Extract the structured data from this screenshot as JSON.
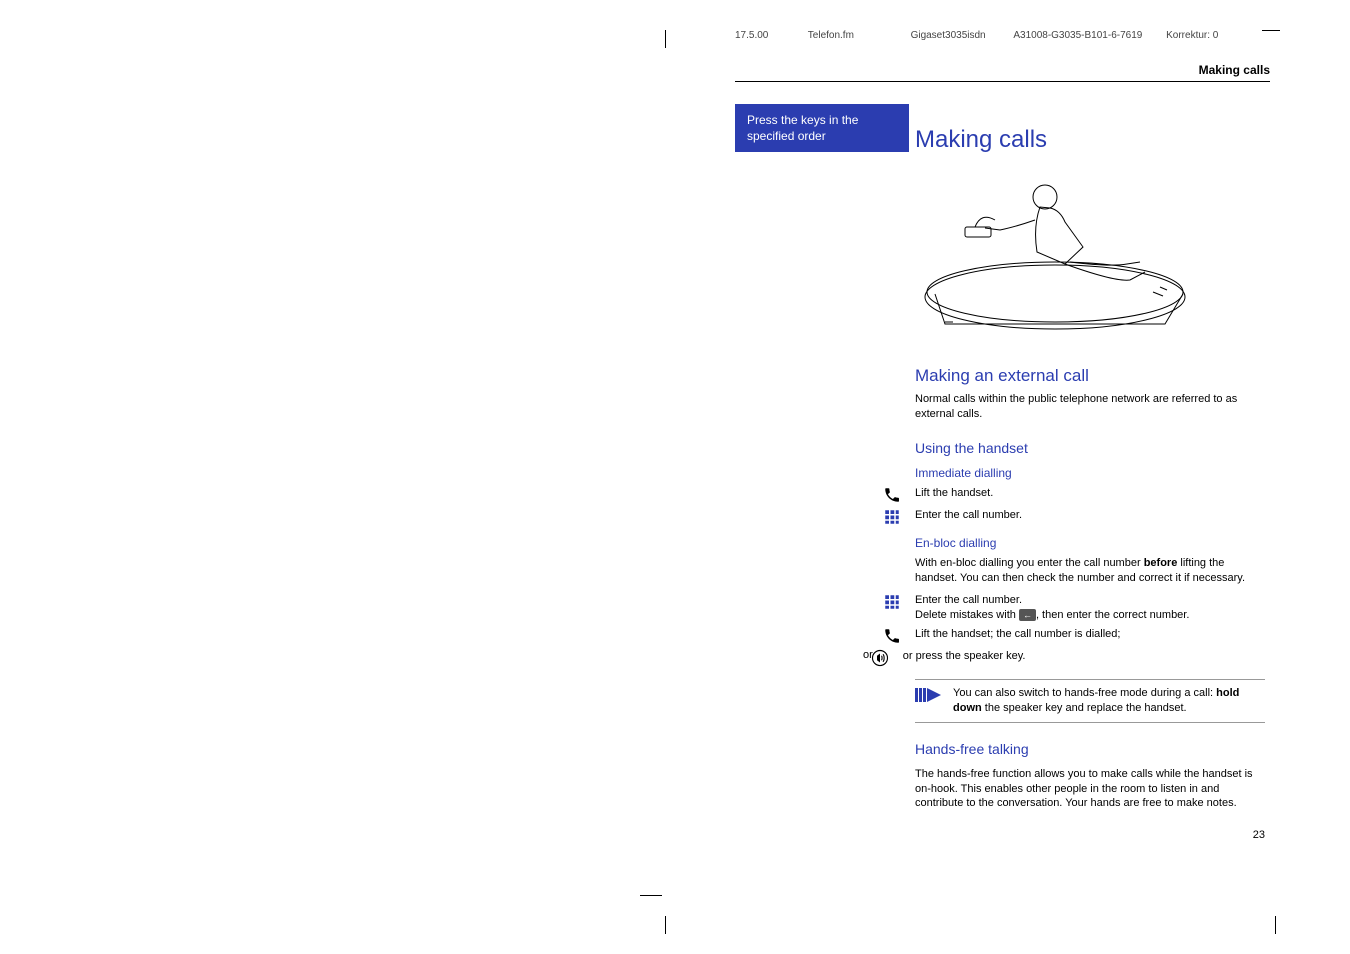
{
  "header": {
    "date": "17.5.00",
    "file": "Telefon.fm",
    "model": "Gigaset3035isdn",
    "partno": "A31008-G3035-B101-6-7619",
    "korrektur": "Korrektur: 0"
  },
  "page_title_right": "Making calls",
  "tip_box": "Press the keys in the specified order",
  "h1": "Making calls",
  "section1": {
    "title": "Making an external call",
    "body": "Normal calls within the public telephone network are referred to as external calls."
  },
  "section2": {
    "title": "Using the handset",
    "immediate": {
      "title": "Immediate dialling",
      "step1": "Lift the handset.",
      "step2": "Enter the call number."
    },
    "enbloc": {
      "title": "En-bloc dialling",
      "intro_before": "With en-bloc dialling you enter the call number ",
      "intro_bold": "before",
      "intro_after": " lifting the handset. You can then check the number and correct it if necessary.",
      "step1a": "Enter the call number.",
      "step1b_before": "Delete mistakes with ",
      "step1b_after": ", then enter the correct number.",
      "step2": "Lift the handset; the call number is dialled;",
      "or_label": "or",
      "step3": "or press the speaker key."
    },
    "note_before": "You can also switch to hands-free mode during a call: ",
    "note_bold": "hold down",
    "note_after": " the speaker key and replace the handset."
  },
  "section3": {
    "title": "Hands-free talking",
    "body": "The hands-free function allows you to make calls while the handset is on-hook. This enables other people in the room to listen in and contribute to the conversation. Your hands are free to make notes."
  },
  "backspace_glyph": "←",
  "page_number": "23"
}
